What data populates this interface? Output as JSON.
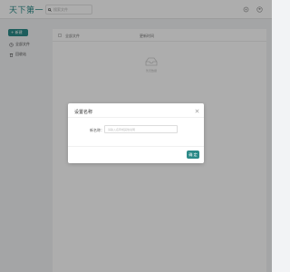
{
  "app": {
    "logo_text": "天下第一"
  },
  "search": {
    "placeholder": "搜索文件",
    "icon": "search-icon"
  },
  "topbar": {
    "icons": [
      "settings-icon",
      "avatar-icon"
    ]
  },
  "sidebar": {
    "new_button_label": "+ 新建",
    "items": [
      {
        "label": "全部文件",
        "icon": "clock-icon"
      },
      {
        "label": "回收站",
        "icon": "trash-icon"
      }
    ]
  },
  "table": {
    "columns": [
      "全部文件",
      "更新时间"
    ],
    "empty_text": "暂无数据"
  },
  "modal": {
    "title": "设置名称",
    "field_label": "新名称：",
    "field_placeholder": "请输入名称或其他说明",
    "confirm_label": "确 定"
  },
  "colors": {
    "accent": "#2c8a88",
    "overlay": "rgba(0,0,0,0.32)"
  }
}
